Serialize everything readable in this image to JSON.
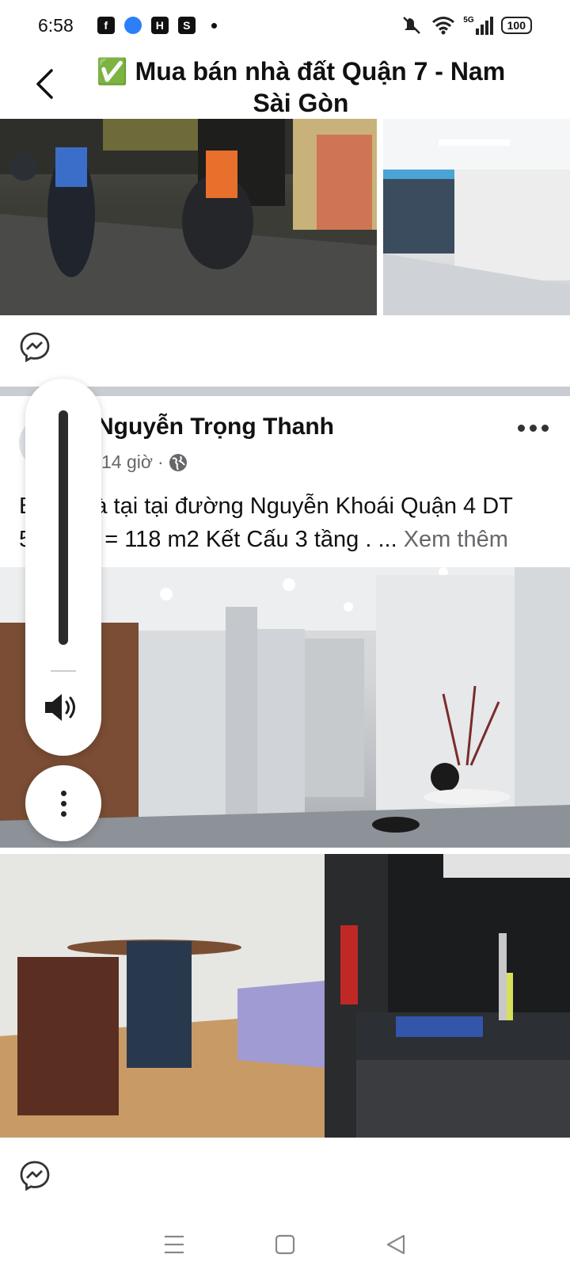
{
  "status_bar": {
    "time": "6:58",
    "left_icons": [
      "facebook-icon",
      "messenger-icon",
      "app-h-icon",
      "shopee-icon",
      "dot-icon"
    ],
    "right_icons": [
      "mute-vibrate-icon",
      "wifi-icon",
      "signal-5g-icon",
      "battery-icon"
    ],
    "network": "5G",
    "battery": "100"
  },
  "header": {
    "title": "✅ Mua bán nhà đất Quận 7 - Nam Sài Gòn",
    "back_icon": "chevron-left-icon"
  },
  "post": {
    "author": "Nguyễn Trọng Thanh",
    "time": "14 giờ",
    "separator": "·",
    "privacy_icon": "globe-icon",
    "text": "Bán nhà tại tại đường Nguyễn Khoái Quận 4 DT 5x23.6 = 118 m2 Kết Cấu 3 tầng . ...",
    "text_visible_line1_start": "B",
    "text_line1_rest": "à tại tại đường Nguyễn Khoái Quận 4 DT",
    "text_line2_start": "5",
    "text_line2_rest": " = 118 m2 Kết Cấu 3 tầng . ...",
    "see_more": "Xem thêm",
    "more_icon": "more-horizontal-icon"
  },
  "volume": {
    "level": 1.0,
    "icon": "speaker-icon"
  },
  "nav": {
    "items": [
      "menu-icon",
      "home-square-icon",
      "back-triangle-icon"
    ]
  }
}
